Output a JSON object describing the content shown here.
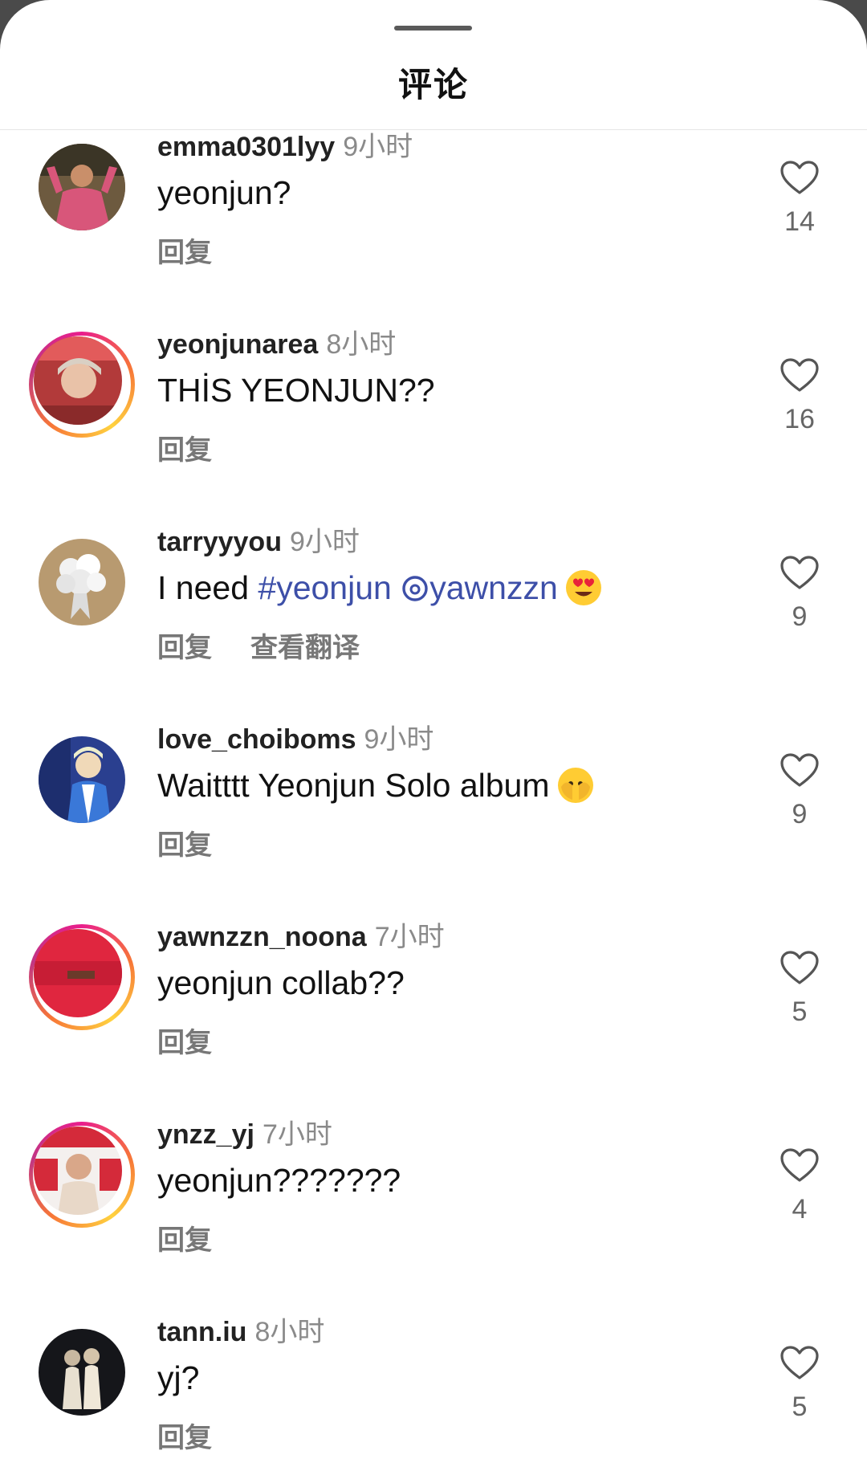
{
  "sheet": {
    "title": "评论"
  },
  "labels": {
    "reply": "回复",
    "translate": "查看翻译"
  },
  "comments": [
    {
      "username": "emma0301lyy",
      "time": "9小时",
      "text": "yeonjun?",
      "likes": "14"
    },
    {
      "username": "yeonjunarea",
      "time": "8小时",
      "text": "THİS YEONJUN??",
      "likes": "16"
    },
    {
      "username": "tarryyyou",
      "time": "9小时",
      "text_prefix": "I need ",
      "hashtag": "#yeonjun",
      "mention": "yawnzzn",
      "emoji": "heart-eyes-emoji",
      "likes": "9"
    },
    {
      "username": "love_choiboms",
      "time": "9小时",
      "text": "Waitttt Yeonjun Solo album",
      "emoji": "peeking-eye-emoji",
      "likes": "9"
    },
    {
      "username": "yawnzzn_noona",
      "time": "7小时",
      "text": "yeonjun collab??",
      "likes": "5"
    },
    {
      "username": "ynzz_yj",
      "time": "7小时",
      "text": "yeonjun???????",
      "likes": "4"
    },
    {
      "username": "tann.iu",
      "time": "8小时",
      "text": "yj?",
      "likes": "5"
    }
  ]
}
